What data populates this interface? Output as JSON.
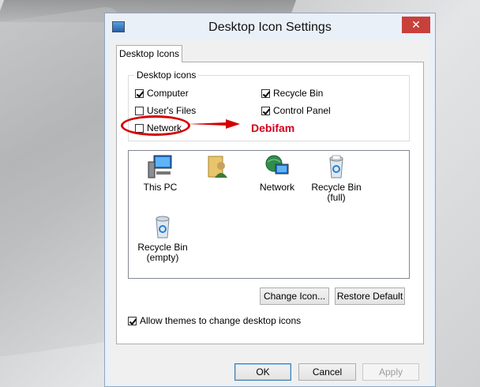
{
  "window": {
    "title": "Desktop Icon Settings",
    "close_glyph": "✕"
  },
  "tab": {
    "label": "Desktop Icons"
  },
  "group": {
    "label": "Desktop icons",
    "checkboxes": [
      {
        "label": "Computer",
        "checked": true
      },
      {
        "label": "User's Files",
        "checked": false
      },
      {
        "label": "Network",
        "checked": false
      },
      {
        "label": "Recycle Bin",
        "checked": true
      },
      {
        "label": "Control Panel",
        "checked": true
      }
    ]
  },
  "annotation": {
    "watermark": "Debifam",
    "color": "#d60000"
  },
  "icons": [
    {
      "label": "This PC",
      "icon": "computer-icon"
    },
    {
      "label": "",
      "icon": "user-folder-icon"
    },
    {
      "label": "Network",
      "icon": "network-icon"
    },
    {
      "label": "Recycle Bin (full)",
      "icon": "recycle-bin-full-icon"
    },
    {
      "label": "Recycle Bin (empty)",
      "icon": "recycle-bin-empty-icon"
    }
  ],
  "buttons": {
    "change_icon": "Change Icon...",
    "restore_default": "Restore Default",
    "ok": "OK",
    "cancel": "Cancel",
    "apply": "Apply"
  },
  "allow_themes": {
    "label": "Allow themes to change desktop icons",
    "checked": true
  },
  "colors": {
    "close": "#c9403b",
    "title_bg": "#eaf0f7",
    "accent": "#3c7fb1"
  }
}
